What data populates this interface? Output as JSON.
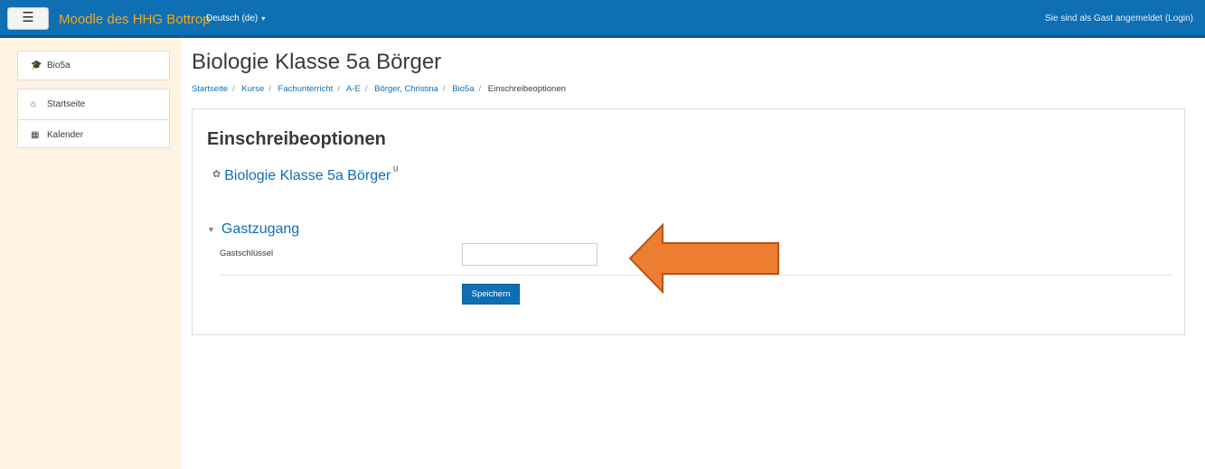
{
  "navbar": {
    "menu_icon": "hamburger-icon",
    "brand": "Moodle des HHG Bottrop",
    "language": "Deutsch (de)",
    "language_caret": "▾",
    "login_text": "Sie sind als Gast angemeldet (Login)"
  },
  "sidebar": {
    "course": {
      "icon": "graduation-cap-icon",
      "label": "Bio5a"
    },
    "items": [
      {
        "icon": "home-icon",
        "label": "Startseite"
      },
      {
        "icon": "calendar-icon",
        "label": "Kalender"
      }
    ]
  },
  "page": {
    "title": "Biologie Klasse 5a Börger",
    "breadcrumb": [
      "Startseite",
      "Kurse",
      "Fachunterricht",
      "A-E",
      "Börger, Christina",
      "Bio5a",
      "Einschreibeoptionen"
    ],
    "breadcrumb_separator": "/"
  },
  "enrol": {
    "heading": "Einschreibeoptionen",
    "course_name": "Biologie Klasse 5a Börger",
    "course_icon": "puzzle-icon",
    "key_icon": "key-icon",
    "section_title": "Gastzugang",
    "field_label": "Gastschlüssel",
    "field_value": "",
    "save_label": "Speichern"
  },
  "colors": {
    "navbar": "#0f6fb3",
    "brand": "#f0a81c",
    "sidebar_bg": "#fff4e2",
    "link": "#0f6fb3",
    "arrow_fill": "#ed7d31",
    "arrow_stroke": "#b4561c"
  }
}
